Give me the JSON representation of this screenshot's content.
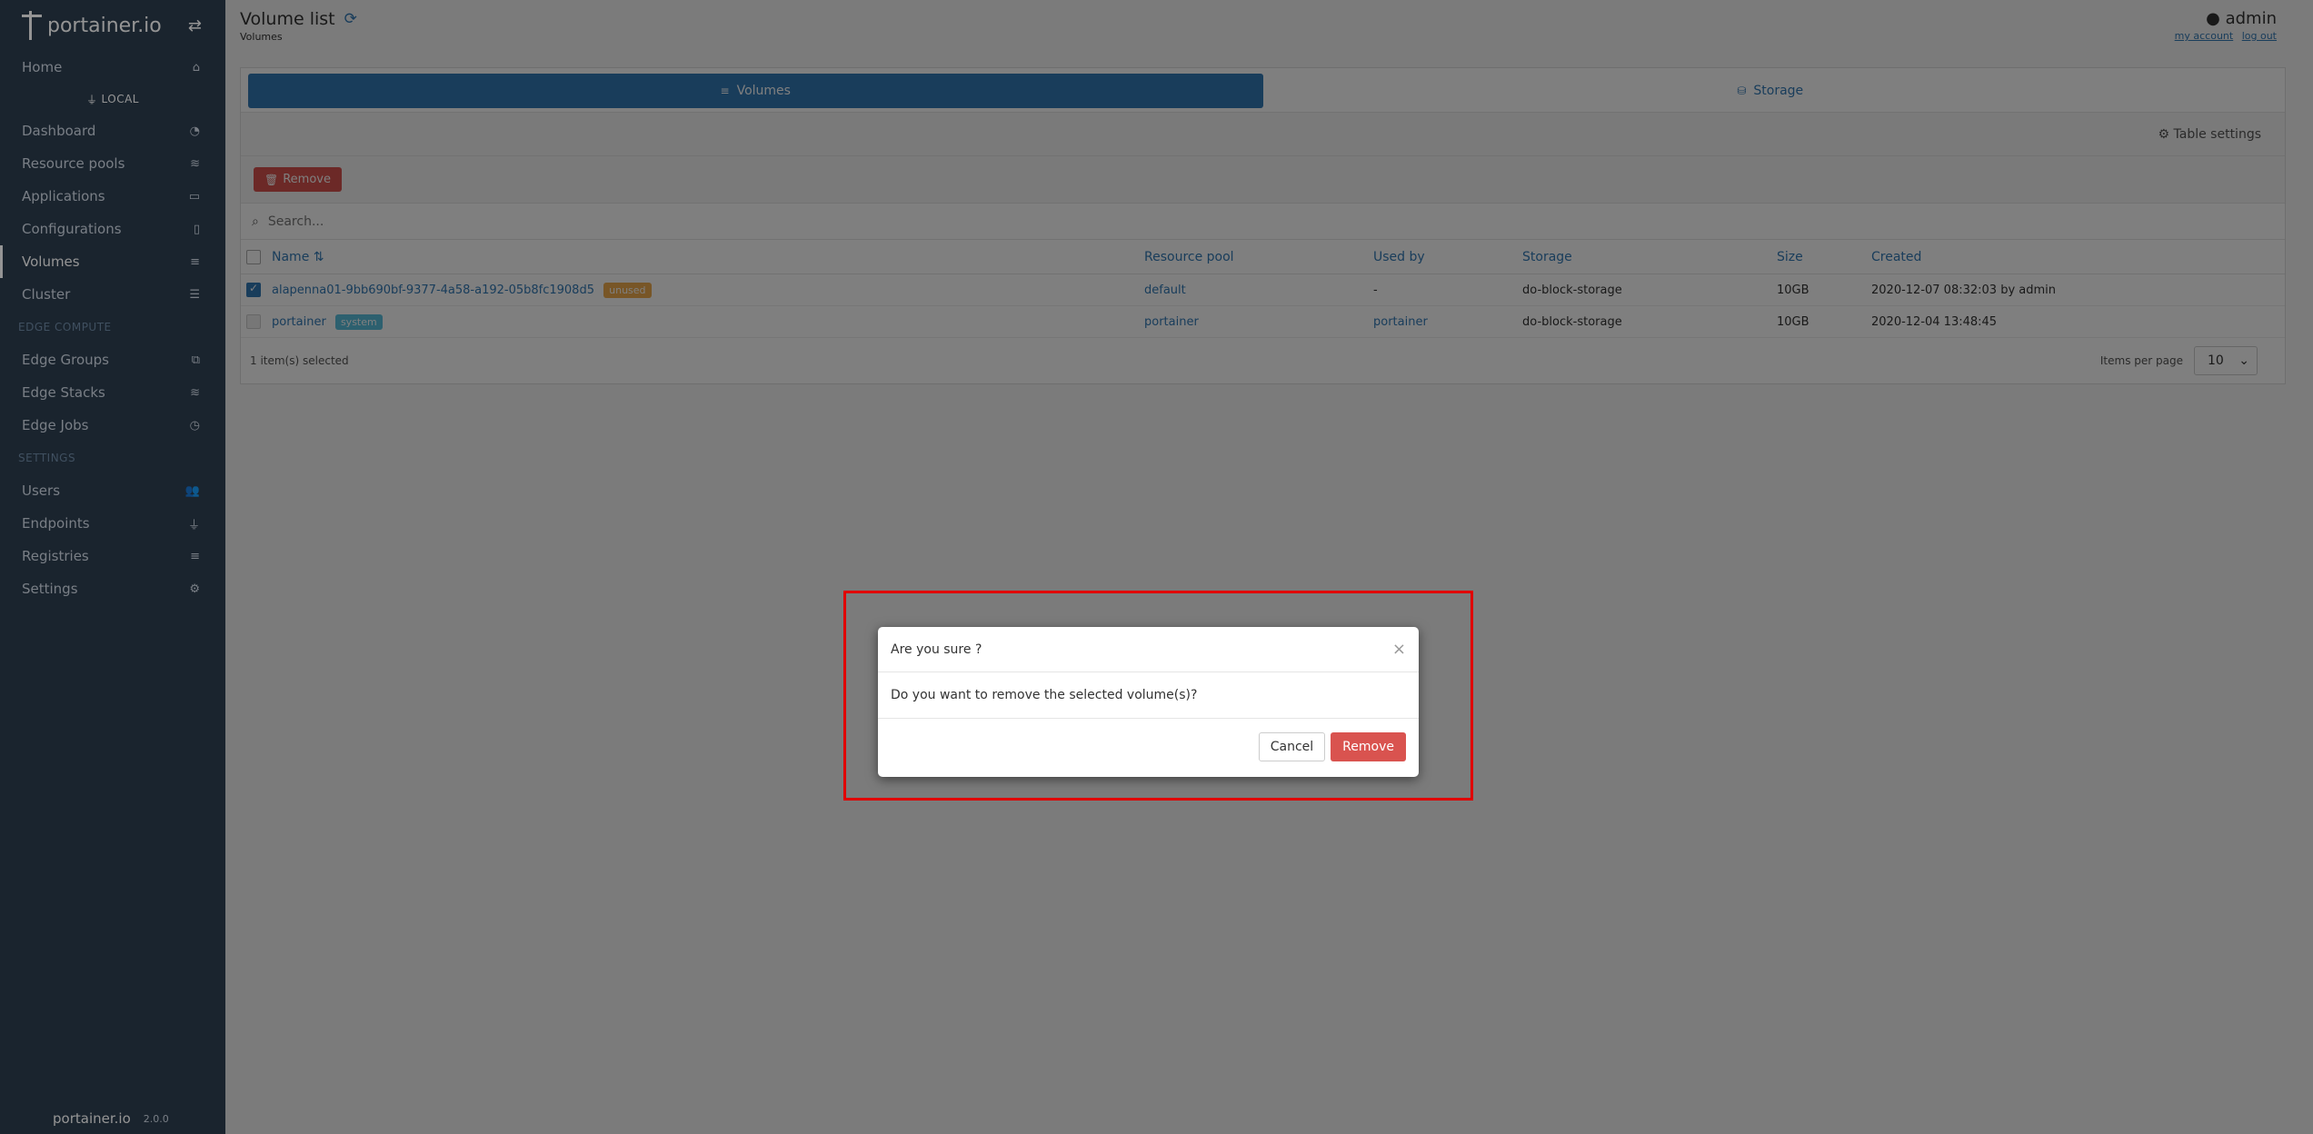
{
  "brand": {
    "name": "portainer.io",
    "version": "2.0.0"
  },
  "sidebar": {
    "home": "Home",
    "endpoint": "LOCAL",
    "items": [
      {
        "label": "Dashboard",
        "icon": "dashboard-icon"
      },
      {
        "label": "Resource pools",
        "icon": "layers-icon"
      },
      {
        "label": "Applications",
        "icon": "laptop-icon"
      },
      {
        "label": "Configurations",
        "icon": "file-icon"
      },
      {
        "label": "Volumes",
        "icon": "database-icon"
      },
      {
        "label": "Cluster",
        "icon": "server-icon"
      }
    ],
    "edge_section": "EDGE COMPUTE",
    "edge_items": [
      {
        "label": "Edge Groups",
        "icon": "object-group-icon"
      },
      {
        "label": "Edge Stacks",
        "icon": "layers-icon"
      },
      {
        "label": "Edge Jobs",
        "icon": "clock-icon"
      }
    ],
    "settings_section": "SETTINGS",
    "settings_items": [
      {
        "label": "Users",
        "icon": "users-icon"
      },
      {
        "label": "Endpoints",
        "icon": "plug-icon"
      },
      {
        "label": "Registries",
        "icon": "database-icon"
      },
      {
        "label": "Settings",
        "icon": "cogs-icon"
      }
    ]
  },
  "header": {
    "title": "Volume list",
    "breadcrumb": "Volumes",
    "user": "admin",
    "my_account": "my account",
    "log_out": "log out"
  },
  "tabs": [
    {
      "label": "Volumes",
      "active": true
    },
    {
      "label": "Storage",
      "active": false
    }
  ],
  "toolbar": {
    "table_settings": "Table settings",
    "remove_label": "Remove",
    "search_placeholder": "Search..."
  },
  "table": {
    "columns": [
      "Name",
      "Resource pool",
      "Used by",
      "Storage",
      "Size",
      "Created"
    ],
    "rows": [
      {
        "checked": true,
        "name": "alapenna01-9bb690bf-9377-4a58-a192-05b8fc1908d5",
        "badge": "unused",
        "resource_pool": "default",
        "used_by": "-",
        "storage": "do-block-storage",
        "size": "10GB",
        "created": "2020-12-07 08:32:03 by admin"
      },
      {
        "checked": false,
        "name": "portainer",
        "badge": "system",
        "resource_pool": "portainer",
        "used_by": "portainer",
        "storage": "do-block-storage",
        "size": "10GB",
        "created": "2020-12-04 13:48:45"
      }
    ],
    "selected_count": "1 item(s) selected",
    "items_per_page_label": "Items per page",
    "items_per_page": "10"
  },
  "modal": {
    "title": "Are you sure ?",
    "body": "Do you want to remove the selected volume(s)?",
    "cancel": "Cancel",
    "confirm": "Remove"
  },
  "colors": {
    "primary": "#337ab7",
    "danger": "#d9534f",
    "highlight": "#e00000",
    "sidebar": "#2d3e50"
  }
}
